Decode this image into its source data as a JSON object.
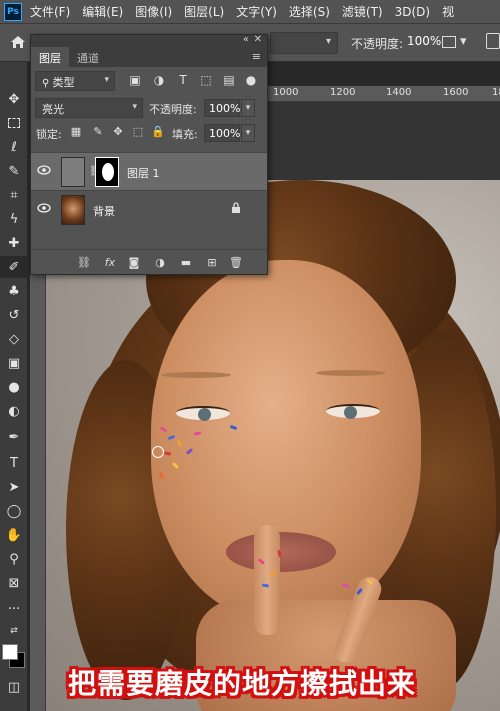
{
  "menu": {
    "items": [
      "文件(F)",
      "编辑(E)",
      "图像(I)",
      "图层(L)",
      "文字(Y)",
      "选择(S)",
      "滤镜(T)",
      "3D(D)",
      "视"
    ]
  },
  "options_bar": {
    "opacity_label": "不透明度:",
    "opacity_value": "100%"
  },
  "rulers": {
    "top_ticks": [
      "1000",
      "1200",
      "1400",
      "1600",
      "18"
    ]
  },
  "toolbar": {
    "tools": [
      "move-tool",
      "marquee-tool",
      "lasso-tool",
      "quick-select-tool",
      "crop-tool",
      "eyedropper-tool",
      "healing-brush-tool",
      "brush-tool",
      "clone-stamp-tool",
      "history-brush-tool",
      "eraser-tool",
      "gradient-tool",
      "blur-tool",
      "dodge-tool",
      "pen-tool",
      "type-tool",
      "path-select-tool",
      "shape-tool",
      "hand-tool",
      "zoom-tool",
      "more-tools"
    ],
    "active_tool": "brush-tool"
  },
  "layers_panel": {
    "tabs": [
      "图层",
      "通道"
    ],
    "active_tab": "图层",
    "filter_kind": "类型",
    "blend_mode": "亮光",
    "opacity_label": "不透明度:",
    "opacity_value": "100%",
    "lock_label": "锁定:",
    "fill_label": "填充:",
    "fill_value": "100%",
    "layers": [
      {
        "name": "图层 1",
        "selected": true,
        "visible": true,
        "has_mask": true
      },
      {
        "name": "背景",
        "selected": false,
        "visible": true,
        "locked": true
      }
    ]
  },
  "canvas": {
    "caption": "把需要磨皮的地方擦拭出来"
  },
  "colors": {
    "foreground": "#ffffff",
    "background": "#000000",
    "caption_outline": "#d21010"
  }
}
